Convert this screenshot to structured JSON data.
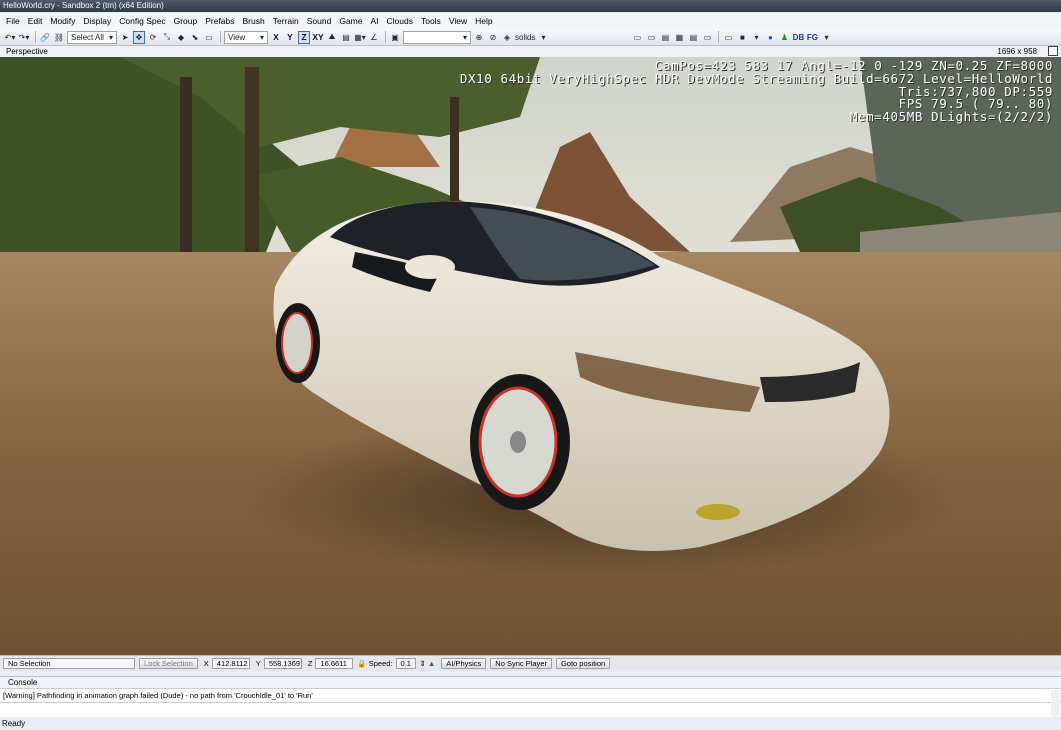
{
  "window": {
    "title": "HelloWorld.cry - Sandbox 2 (tm) (x64 Edition)"
  },
  "menu": [
    "File",
    "Edit",
    "Modify",
    "Display",
    "Config Spec",
    "Group",
    "Prefabs",
    "Brush",
    "Terrain",
    "Sound",
    "Game",
    "AI",
    "Clouds",
    "Tools",
    "View",
    "Help"
  ],
  "toolbar": {
    "select_all": "Select All",
    "view_combo": "View",
    "axis_x": "X",
    "axis_y": "Y",
    "axis_z": "Z",
    "axis_xy": "XY",
    "solids": "solids",
    "db": "DB",
    "fg": "FG"
  },
  "viewport": {
    "name": "Perspective",
    "resolution": "1696 x 958",
    "hud": [
      "CamPos=423 583  17 Angl=-12  0 -129 ZN=0.25 ZF=8000",
      "DX10 64bit VeryHighSpec HDR DevMode Streaming Build=6672 Level=HelloWorld",
      "Tris:737,800  DP:559",
      "FPS  79.5 ( 79.. 80)",
      "Mem=405MB DLights=(2/2/2)"
    ]
  },
  "statusbar": {
    "selection": "No Selection",
    "lock_selection": "Lock Selection",
    "x_label": "X",
    "x_value": "412.8112",
    "y_label": "Y",
    "y_value": "558.1369",
    "z_label": "Z",
    "z_value": "16.6611",
    "speed_label": "Speed:",
    "speed_value": "0.1",
    "ai_physics": "AI/Physics",
    "no_sync_player": "No Sync Player",
    "goto_position": "Goto position"
  },
  "console": {
    "title": "Console",
    "lines": [
      "[Warning] Pathfinding in animation graph failed (Dude) - no path from 'CrouchIdle_01' to 'Run'"
    ]
  },
  "status": {
    "ready": "Ready"
  },
  "colors": {
    "sky": "#d9dcd4",
    "ground": "#8a6a46",
    "car_body": "#ece6d8",
    "rim": "#c8342a"
  }
}
